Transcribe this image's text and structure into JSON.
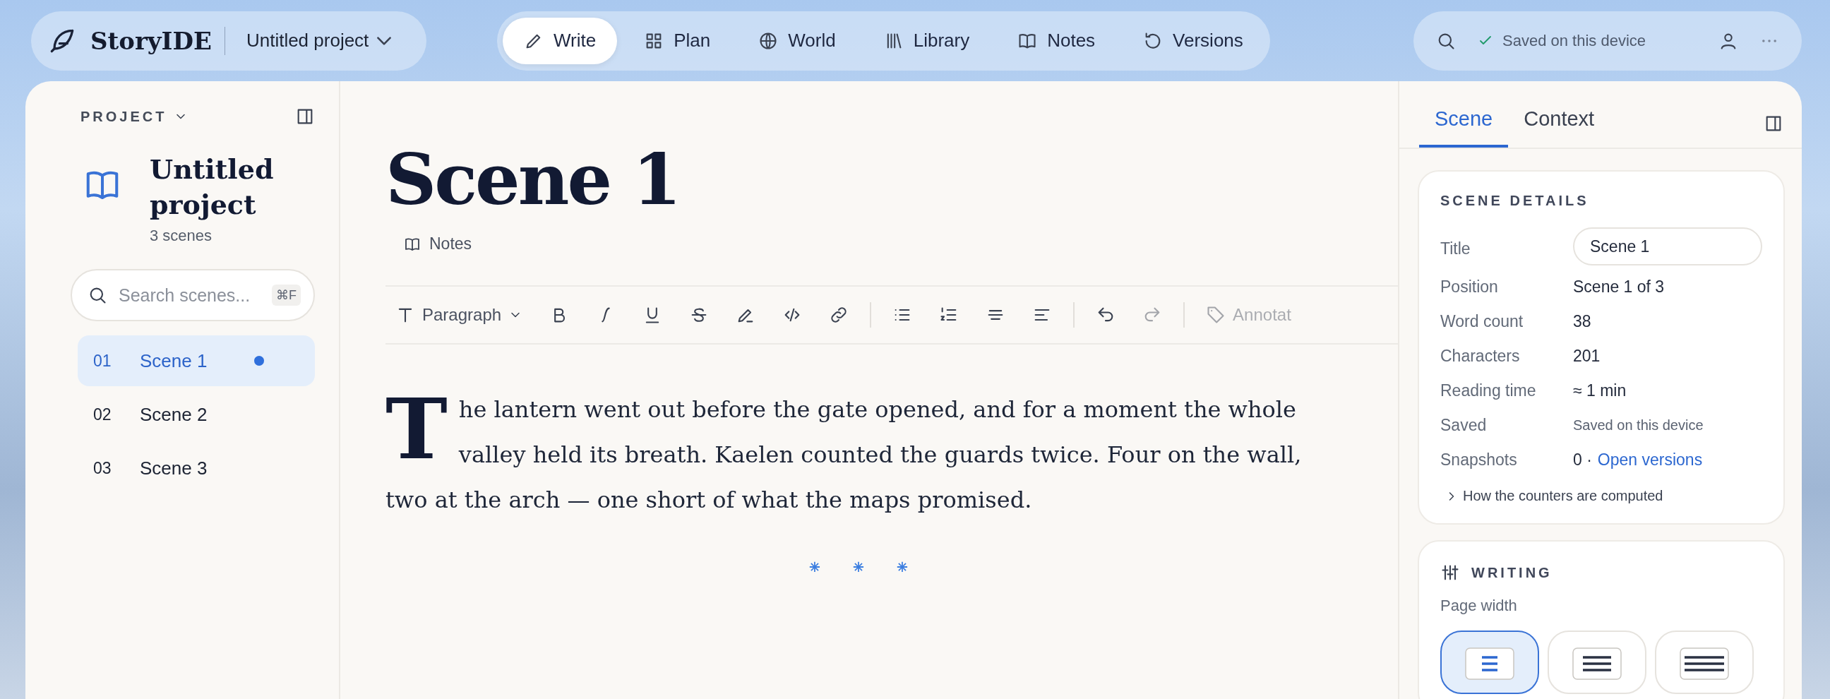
{
  "brand": {
    "name": "StoryIDE",
    "project": "Untitled project"
  },
  "nav": [
    {
      "label": "Write",
      "kind": "write",
      "selected": true
    },
    {
      "label": "Plan",
      "kind": "plan",
      "selected": false
    },
    {
      "label": "World",
      "kind": "world",
      "selected": false
    },
    {
      "label": "Library",
      "kind": "library",
      "selected": false
    },
    {
      "label": "Notes",
      "kind": "notes",
      "selected": false
    },
    {
      "label": "Versions",
      "kind": "versions",
      "selected": false
    }
  ],
  "status": {
    "text": "Saved on this device"
  },
  "sidebar": {
    "heading": "PROJECT",
    "project_title": "Untitled project",
    "scene_count": "3 scenes",
    "search": {
      "placeholder": "Search scenes...",
      "shortcut": "⌘F"
    },
    "scenes": [
      {
        "number": "01",
        "title": "Scene 1",
        "selected": true,
        "modified": true
      },
      {
        "number": "02",
        "title": "Scene 2",
        "selected": false,
        "modified": false
      },
      {
        "number": "03",
        "title": "Scene 3",
        "selected": false,
        "modified": false
      }
    ]
  },
  "editor": {
    "title": "Scene 1",
    "notes_link": "Notes",
    "style_menu": "Paragraph",
    "toolbar": [
      {
        "kind": "bold",
        "disabled": false
      },
      {
        "kind": "italic",
        "disabled": false
      },
      {
        "kind": "underline",
        "disabled": false
      },
      {
        "kind": "strike",
        "disabled": false
      },
      {
        "kind": "highlight",
        "disabled": false
      },
      {
        "kind": "code",
        "disabled": false
      },
      {
        "kind": "link",
        "disabled": false
      },
      {
        "kind": "sep"
      },
      {
        "kind": "bullets",
        "disabled": false
      },
      {
        "kind": "numbered",
        "disabled": false
      },
      {
        "kind": "center",
        "disabled": false
      },
      {
        "kind": "left",
        "disabled": false
      },
      {
        "kind": "sep"
      },
      {
        "kind": "undo",
        "disabled": false
      },
      {
        "kind": "redo",
        "disabled": true
      },
      {
        "kind": "sep"
      },
      {
        "kind": "annotate",
        "label": "Annotat",
        "disabled": true
      }
    ],
    "paragraph": {
      "drop_cap": "T",
      "text": "he lantern went out before the gate opened, and for a moment the whole valley held its breath. Kaelen counted the guards twice. Four on the wall, two at the arch — one short of what the maps promised."
    },
    "scene_break": [
      "⁕",
      "⁕",
      "⁕"
    ]
  },
  "panel": {
    "tabs": [
      {
        "label": "Scene",
        "selected": true
      },
      {
        "label": "Context",
        "selected": false
      }
    ],
    "details": {
      "heading": "SCENE DETAILS",
      "title_label": "Title",
      "title_value": "Scene 1",
      "rows": [
        {
          "label": "Position",
          "value": "Scene 1 of 3"
        },
        {
          "label": "Word count",
          "value": "38"
        },
        {
          "label": "Characters",
          "value": "201"
        },
        {
          "label": "Reading time",
          "value": "≈ 1 min"
        },
        {
          "label": "Saved",
          "value": "Saved on this device",
          "kind": "muted"
        },
        {
          "label": "Snapshots",
          "value": "0 ·",
          "link": "Open versions"
        }
      ],
      "disclosure": "How the counters are computed"
    },
    "writing": {
      "heading": "WRITING",
      "page_width_label": "Page width",
      "widths": [
        {
          "kind": "narrow",
          "selected": true
        },
        {
          "kind": "medium",
          "selected": false
        },
        {
          "kind": "wide",
          "selected": false
        }
      ]
    }
  }
}
